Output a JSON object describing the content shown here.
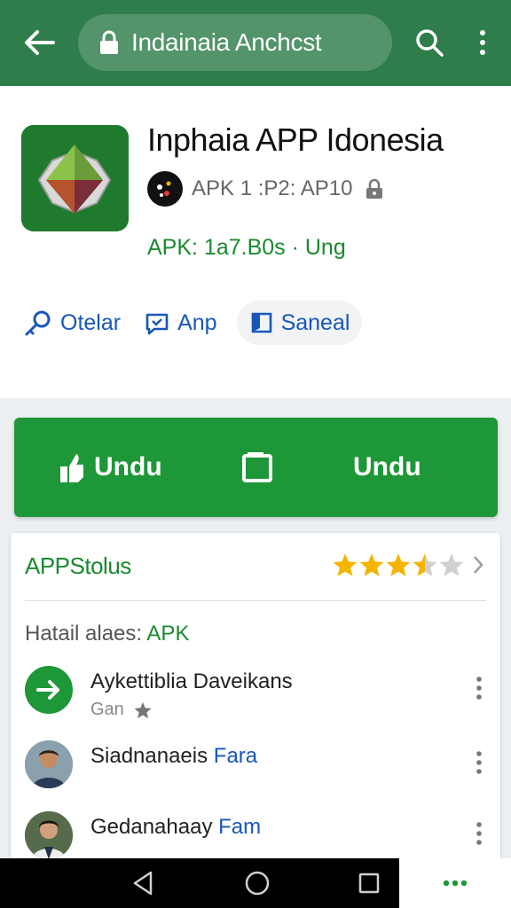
{
  "topbar": {
    "url": "Indainaia Anchcst",
    "back_icon": "arrow-left-icon",
    "lock_icon": "lock-icon",
    "search_icon": "search-icon",
    "more_icon": "more-vertical-icon"
  },
  "app": {
    "title": "Inphaia APP Idonesia",
    "meta": "APK 1 :P2: AP10",
    "size_line": "APK: 1a7.B0s · Ung",
    "icon": "app-logo-icon"
  },
  "chips": [
    {
      "label": "Otelar",
      "icon": "key-icon"
    },
    {
      "label": "Anp",
      "icon": "chat-icon"
    },
    {
      "label": "Saneal",
      "icon": "flag-icon"
    }
  ],
  "download": {
    "left_label": "Undu",
    "right_label": "Undu",
    "left_icon": "share-icon",
    "mid_icon": "copy-icon"
  },
  "status": {
    "heading": "APPStolus",
    "rating": 3.5,
    "rating_max": 5,
    "sub_label": "Hatail alaes:",
    "sub_label_accent": "APK",
    "rows": [
      {
        "name": "Aykettiblia Daveikans",
        "name_accent": "",
        "sub": "Gan",
        "avatar": "arrow-right-icon"
      },
      {
        "name": "Siadnanaeis",
        "name_accent": "Fara",
        "sub": "",
        "avatar": "person-avatar"
      },
      {
        "name": "Gedanahaay",
        "name_accent": "Fam",
        "sub": "",
        "avatar": "person-avatar"
      }
    ]
  },
  "colors": {
    "topbar": "#2e7d4a",
    "accent_green": "#1e9738",
    "link_blue": "#1857b8",
    "star": "#f4b400"
  },
  "navbar": {
    "back_icon": "triangle-back-icon",
    "home_icon": "circle-home-icon",
    "recent_icon": "square-recents-icon",
    "extra_icon": "more-horizontal-icon"
  }
}
